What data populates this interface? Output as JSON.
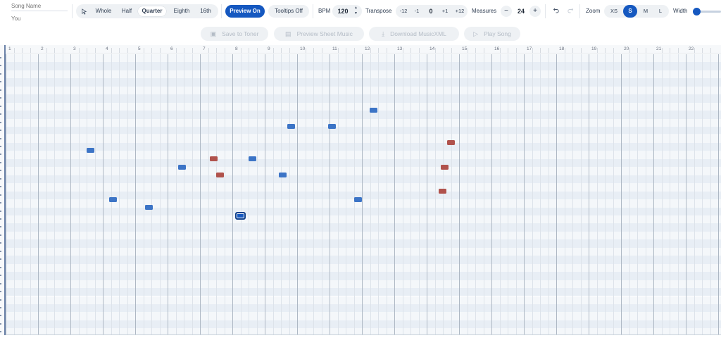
{
  "song": {
    "name_placeholder": "Song Name",
    "author_placeholder": "You"
  },
  "toolbar": {
    "select_tool_icon": "cursor-arrow-icon",
    "durations": [
      "Whole",
      "Half",
      "Quarter",
      "Eighth",
      "16th"
    ],
    "active_duration": "Quarter",
    "preview_label": "Preview On",
    "tooltips_label": "Tooltips Off",
    "bpm_label": "BPM",
    "bpm_value": "120",
    "transpose_label": "Transpose",
    "transpose_buttons": [
      "-12",
      "-1",
      "+1",
      "+12"
    ],
    "transpose_value": "0",
    "measures_label": "Measures",
    "measures_value": "24",
    "measures_minus": "−",
    "measures_plus": "+",
    "undo_icon": "undo-icon",
    "redo_icon": "redo-icon",
    "zoom_label": "Zoom",
    "zoom_options": [
      "XS",
      "S",
      "M",
      "L"
    ],
    "active_zoom": "S",
    "width_label": "Width",
    "width_slider_level": 0.0
  },
  "actions": {
    "save": "Save to Toner",
    "preview_sheet": "Preview Sheet Music",
    "download": "Download MusicXML",
    "play": "Play Song"
  },
  "ruler": {
    "measure_numbers": [
      "1",
      "2",
      "3",
      "4",
      "5",
      "6",
      "7",
      "8",
      "9",
      "10",
      "11",
      "12",
      "13",
      "14",
      "15",
      "16",
      "17",
      "18",
      "19",
      "20",
      "21",
      "22"
    ]
  },
  "colors": {
    "accent": "#1558c0",
    "note_blue": "#3c74c6",
    "note_red": "#b0524c"
  }
}
